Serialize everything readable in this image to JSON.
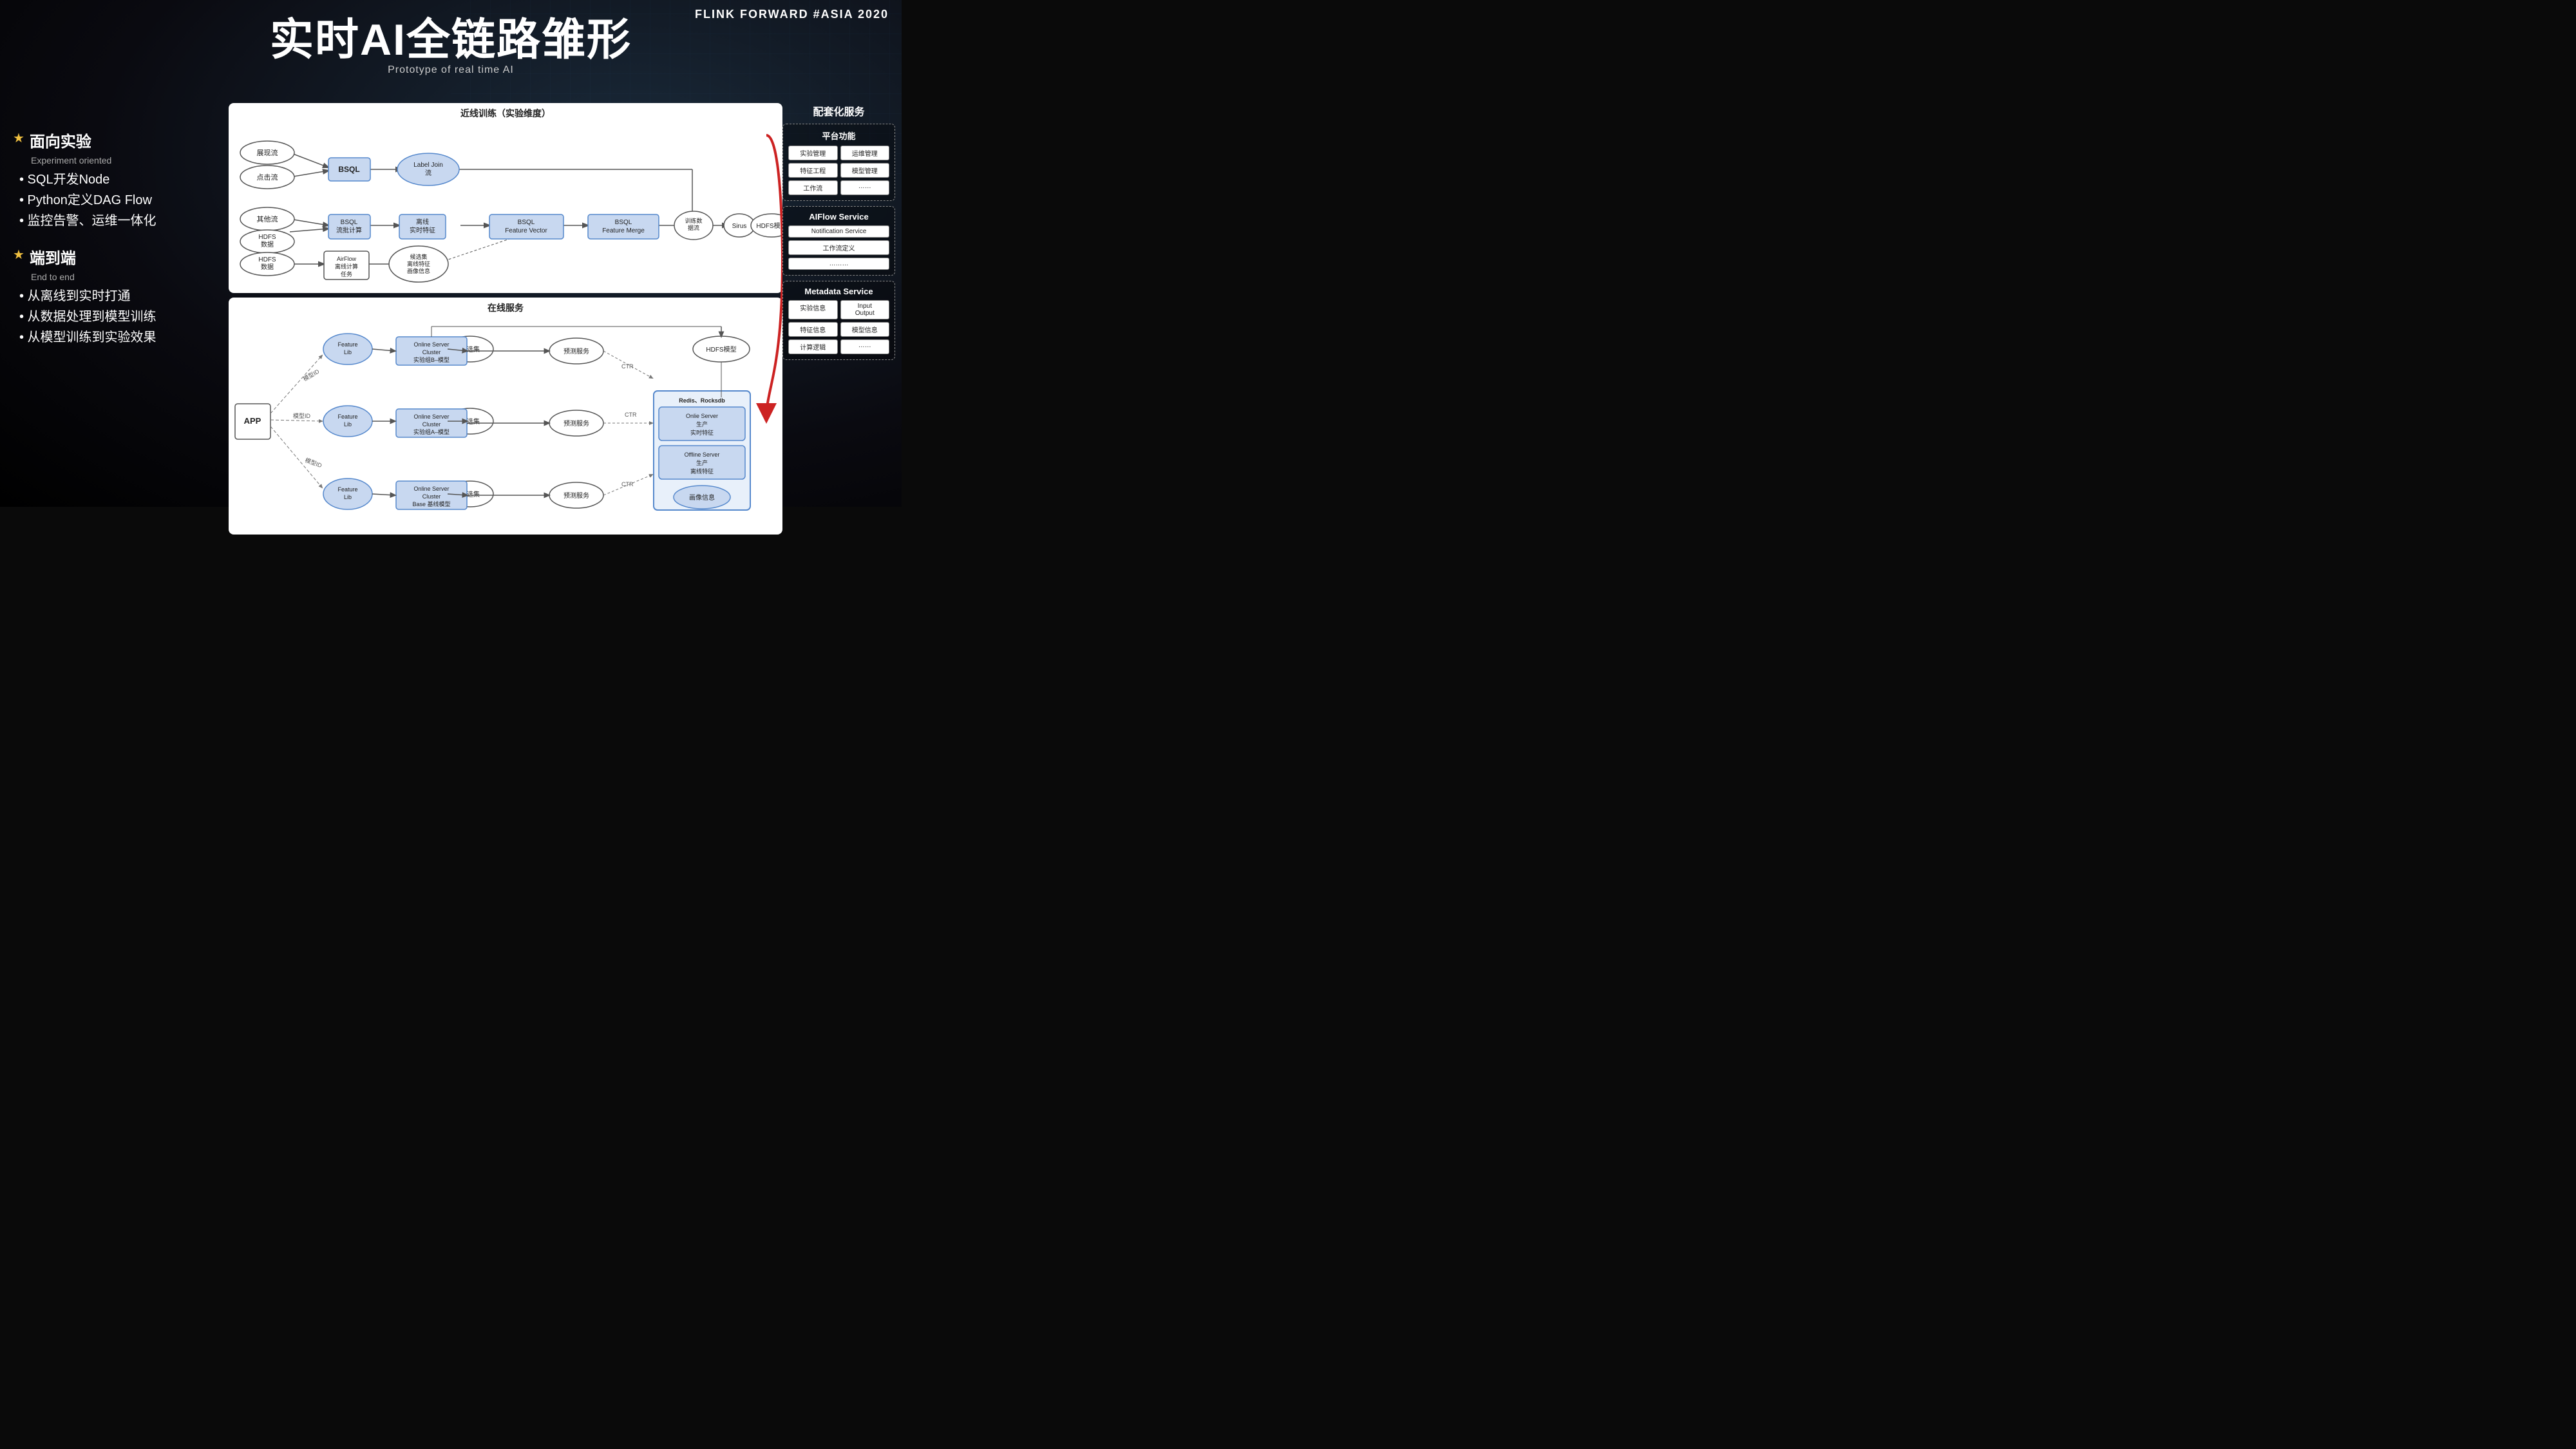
{
  "header": {
    "logo": "FLINK FORWARD #ASIA 2020"
  },
  "title": {
    "main": "实时AI全链路雏形",
    "subtitle": "Prototype of real time AI"
  },
  "left": {
    "section1": {
      "star": "★",
      "label": "面向实验",
      "sub": "Experiment oriented",
      "bullets": [
        "• SQL开发Node",
        "• Python定义DAG Flow",
        "• 监控告警、运维一体化"
      ]
    },
    "section2": {
      "star": "★",
      "label": "端到端",
      "sub": "End to end",
      "bullets": [
        "• 从离线到实时打通",
        "• 从数据处理到模型训练",
        "• 从模型训练到实验效果"
      ]
    }
  },
  "top_diagram": {
    "title": "近线训练（实验维度）",
    "nodes": {
      "zhanxianliu": "展现流",
      "dianjiliu": "点击流",
      "qitaliu": "其他流",
      "hdfs1": "HDFS\n数据",
      "hdfs2": "HDFS\n数据",
      "bsql1": "BSQL",
      "label_join": "Label Join\n流",
      "bsql_liupiji": "BSQL\n流批计算",
      "lixian_shishi": "离线\n实时特征",
      "bsql_feature_vector": "BSQL\nFeature Vector",
      "bsql_feature_merge": "BSQL\nFeature Merge",
      "xunlianshu": "训练数\n据流",
      "sirus": "Sirus",
      "hdfs_model": "HDFS模型",
      "airflow": "AirFlow\n离线计算\n任务",
      "houxuanji": "候选集\n离线特征\n画像信息"
    }
  },
  "bottom_diagram": {
    "title": "在线服务",
    "nodes": {
      "app": "APP",
      "feature_lib_1": "Feature\nLib",
      "feature_lib_2": "Feature\nLib",
      "feature_lib_3": "Feature\nLib",
      "houxuanji_1": "候选集",
      "houxuanji_2": "候选集",
      "houxuanji_3": "候选集",
      "online_server_b": "Online Server\nCluster\n实验组B–模型",
      "online_server_a": "Online Server\nCluster\n实验组A–模型",
      "online_server_base": "Online Server\nCluster\nBase 基线模型",
      "yuce_b": "预测服务",
      "yuce_a": "预测服务",
      "yuce_base": "预测服务",
      "redis_title": "Redis、Rocksdb",
      "online_server_prod": "Onlie Server\n生产\n实时特征",
      "offline_server_prod": "Offline Server\n生产\n离线特征",
      "huaxiang": "画像信息",
      "hdfs_model": "HDFS模型",
      "moxing_id_1": "模型ID",
      "moxing_id_2": "模型ID",
      "moxing_id_3": "模型ID",
      "ctr_1": "CTR",
      "ctr_2": "CTR",
      "ctr_3": "CTR"
    }
  },
  "right": {
    "title": "配套化服务",
    "platform": {
      "title": "平台功能",
      "items": [
        "实验管理",
        "运维管理",
        "特征工程",
        "模型管理",
        "工作流",
        "……"
      ]
    },
    "aiflow": {
      "title": "AIFlow Service",
      "items": [
        "Notification Service",
        "工作流定义",
        "………"
      ]
    },
    "metadata": {
      "title": "Metadata Service",
      "items": [
        "实验信息",
        "Input\nOutput",
        "特征信息",
        "模型信息",
        "计算逻辑",
        "……"
      ]
    }
  },
  "colors": {
    "accent_red": "#e84040",
    "node_blue": "#c8d8f0",
    "border_blue": "#5588cc",
    "text_dark": "#222222",
    "bg_dark": "#0a0a0a",
    "white": "#ffffff"
  }
}
